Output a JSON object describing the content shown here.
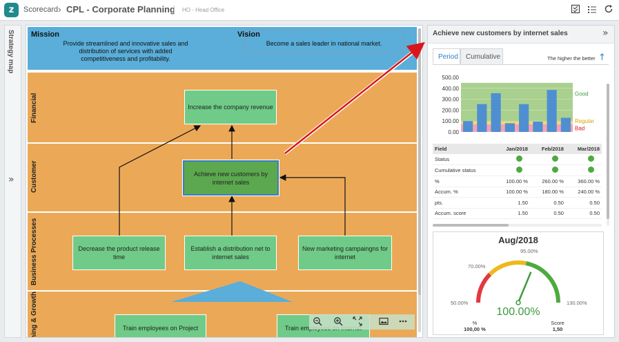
{
  "header": {
    "logo_glyph": "z",
    "crumb_root": "Scorecard",
    "crumb_sep": "›",
    "title": "CPL - Corporate Planning",
    "subtitle": "HO - Head Office",
    "icons": [
      "checklist-icon",
      "list-icon",
      "refresh-icon"
    ]
  },
  "sidebar": {
    "label": "Strategy map",
    "expand_glyph": "»"
  },
  "map": {
    "mission_title": "Mission",
    "mission_text": "Provide streamlined and innovative sales and distribution of services with added competitiveness and profitability.",
    "vision_title": "Vision",
    "vision_text": "Become a sales leader in national market.",
    "perspectives": [
      "Financial",
      "Customer",
      "Business Processes",
      "Learning & Growth"
    ],
    "objectives": {
      "financial": "Increase the company revenue",
      "customer": "Achieve new customers by internet sales",
      "bp1": "Decrease the product release time",
      "bp2": "Establish a distribution net to internet sales",
      "bp3": "New marketing campaingns for internet",
      "lg1": "Train employees on Project",
      "lg2": "Train employees on internet"
    },
    "toolbar": [
      "zoom-out-icon",
      "zoom-in-icon",
      "fit-icon",
      "image-icon",
      "more-icon"
    ]
  },
  "panel": {
    "title": "Achieve new customers by internet sales",
    "collapse_glyph": "»",
    "tabs": [
      "Period",
      "Cumulative"
    ],
    "active_tab": "Period",
    "polarity_text": "The higher the better",
    "polarity_glyph": "↑",
    "table": {
      "headers": [
        "Field",
        "Jan/2018",
        "Feb/2018",
        "Mar/2018"
      ],
      "rows": [
        [
          "Status",
          "",
          "",
          ""
        ],
        [
          "Cumulative status",
          "",
          "",
          ""
        ],
        [
          "%",
          "100.00 %",
          "260.00 %",
          "360.00 %"
        ],
        [
          "Accum. %",
          "100.00 %",
          "180.00 %",
          "240.00 %"
        ],
        [
          "pts.",
          "1.50",
          "0.50",
          "0.50"
        ],
        [
          "Accum. score",
          "1.50",
          "0.50",
          "0.50"
        ]
      ]
    },
    "gauge": {
      "title": "Aug/2018",
      "value": 100,
      "value_text": "100.00%",
      "tick_50": "50.00%",
      "tick_70": "70.00%",
      "tick_95": "95.00%",
      "tick_130": "130.00%",
      "footer_left_label": "%",
      "footer_left_value": "100,00 %",
      "footer_right_label": "Score",
      "footer_right_value": "1,50",
      "colors": {
        "bad": "#e2383f",
        "regular": "#efb81c",
        "good": "#4eaa3e"
      }
    }
  },
  "chart_data": {
    "type": "bar",
    "y_ticks": [
      "500.00",
      "400.00",
      "300.00",
      "200.00",
      "100.00",
      "0.00"
    ],
    "ylim": [
      0,
      500
    ],
    "values": [
      100,
      255,
      355,
      80,
      255,
      95,
      385,
      130
    ],
    "bands": [
      {
        "name": "Good",
        "from": 95,
        "to": 450,
        "color": "#a9d08e"
      },
      {
        "name": "Regular",
        "from": 70,
        "to": 95,
        "color": "#f5d76e"
      },
      {
        "name": "Bad",
        "from": 0,
        "to": 70,
        "color": "#f2a3b5"
      }
    ],
    "bar_color": "#4f8fd1",
    "grid": true
  }
}
